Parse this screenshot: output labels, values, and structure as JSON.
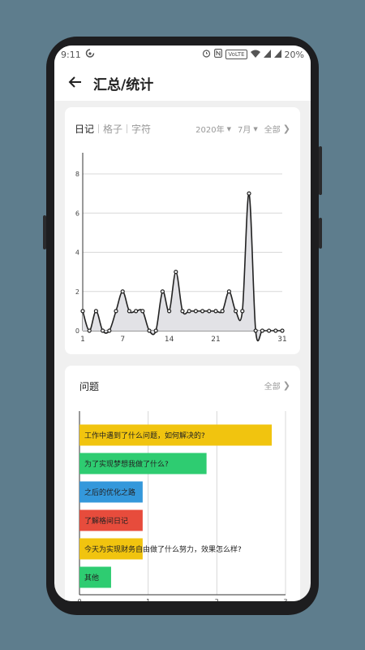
{
  "status_bar": {
    "time": "9:11",
    "sync_icon": "sync-icon",
    "volte": "VoLTE",
    "battery": "20%"
  },
  "app_bar": {
    "title": "汇总/统计",
    "back_icon": "arrow-left-icon"
  },
  "stats_card": {
    "tabs": [
      {
        "label": "日记",
        "active": true
      },
      {
        "label": "格子",
        "active": false
      },
      {
        "label": "字符",
        "active": false
      }
    ],
    "year": "2020年",
    "month": "7月",
    "all_label": "全部"
  },
  "questions_card": {
    "title": "问题",
    "all_label": "全部"
  },
  "colors": {
    "yellow": "#f1c40f",
    "green": "#2ecc71",
    "blue": "#3498db",
    "red": "#e74c3c",
    "line": "#222222",
    "area": "#e2e2e6"
  },
  "chart_data": [
    {
      "type": "area",
      "x": [
        1,
        2,
        3,
        4,
        5,
        6,
        7,
        8,
        9,
        10,
        11,
        12,
        13,
        14,
        15,
        16,
        17,
        18,
        19,
        20,
        21,
        22,
        23,
        24,
        25,
        26,
        27,
        28,
        29,
        30,
        31
      ],
      "series": [
        {
          "values": [
            1,
            0,
            1,
            0,
            0,
            1,
            2,
            1,
            1,
            1,
            0,
            0,
            2,
            1,
            3,
            1,
            1,
            1,
            1,
            1,
            1,
            1,
            2,
            1,
            1,
            7,
            0,
            0,
            0,
            0,
            0
          ]
        }
      ],
      "x_ticks": [
        "1",
        "7",
        "14",
        "21",
        "31"
      ],
      "y_ticks": [
        "0",
        "2",
        "4",
        "6",
        "8"
      ],
      "xlim": [
        1,
        31
      ],
      "ylim": [
        0,
        8
      ],
      "grid": true
    },
    {
      "type": "bar",
      "orientation": "horizontal",
      "categories": [
        "工作中遇到了什么问题，如何解决的?",
        "为了实现梦想我做了什么?",
        "之后的优化之路",
        "了解格间日记",
        "今天为实现财务自由做了什么努力，效果怎么样?",
        "其他"
      ],
      "values": [
        2.8,
        1.85,
        0.92,
        0.92,
        0.92,
        0.46
      ],
      "bar_colors": [
        "#f1c40f",
        "#2ecc71",
        "#3498db",
        "#e74c3c",
        "#f1c40f",
        "#2ecc71"
      ],
      "x_ticks": [
        "0",
        "1",
        "2",
        "3"
      ],
      "xlim": [
        0,
        3
      ],
      "grid": true
    }
  ]
}
